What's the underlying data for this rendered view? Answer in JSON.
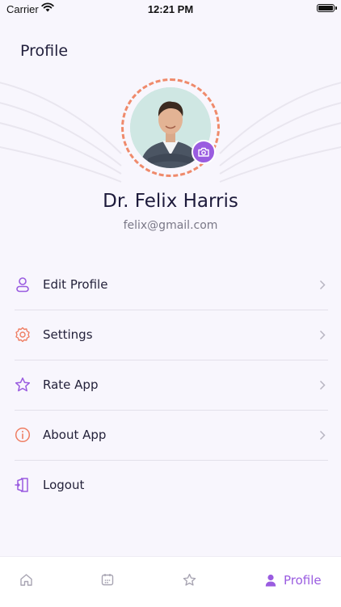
{
  "status_bar": {
    "carrier": "Carrier",
    "time": "12:21 PM"
  },
  "header": {
    "title": "Profile"
  },
  "profile": {
    "name": "Dr. Felix Harris",
    "email": "felix@gmail.com",
    "avatar_icon": "person-photo",
    "edit_photo_icon": "camera-icon"
  },
  "menu": {
    "items": [
      {
        "label": "Edit Profile",
        "icon": "user-icon",
        "color": "#9a5ce0"
      },
      {
        "label": "Settings",
        "icon": "gear-icon",
        "color": "#ef7e63"
      },
      {
        "label": "Rate App",
        "icon": "star-icon",
        "color": "#9a5ce0"
      },
      {
        "label": "About App",
        "icon": "info-icon",
        "color": "#ef7e63"
      },
      {
        "label": "Logout",
        "icon": "logout-icon",
        "color": "#9a5ce0"
      }
    ]
  },
  "tab_bar": {
    "tabs": [
      {
        "icon": "home-icon"
      },
      {
        "icon": "calendar-icon"
      },
      {
        "icon": "star-icon"
      },
      {
        "icon": "profile-icon",
        "label": "Profile",
        "active": true
      }
    ],
    "active_color": "#9a5ce0"
  }
}
